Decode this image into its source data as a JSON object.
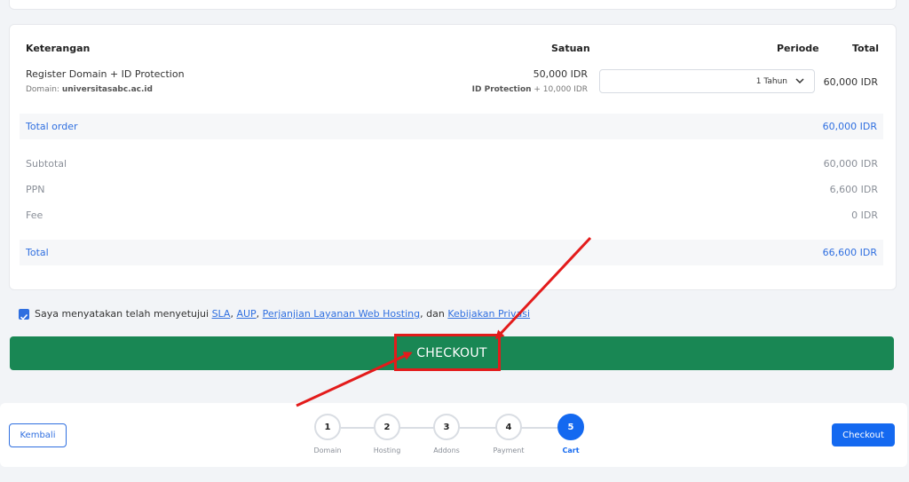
{
  "table": {
    "headers": {
      "keterangan": "Keterangan",
      "satuan": "Satuan",
      "periode": "Periode",
      "total": "Total"
    },
    "item": {
      "name": "Register Domain + ID Protection",
      "domain_label": "Domain:",
      "domain_value": "universitasabc.ac.id",
      "price": "50,000 IDR",
      "extra_label": "ID Protection",
      "extra_value": "+ 10,000 IDR",
      "period": "1 Tahun",
      "total": "60,000 IDR"
    },
    "total_order": {
      "label": "Total order",
      "value": "60,000 IDR"
    },
    "summary": [
      {
        "label": "Subtotal",
        "value": "60,000 IDR"
      },
      {
        "label": "PPN",
        "value": "6,600 IDR"
      },
      {
        "label": "Fee",
        "value": "0 IDR"
      }
    ],
    "grand_total": {
      "label": "Total",
      "value": "66,600 IDR"
    }
  },
  "agreement": {
    "prefix": "Saya menyatakan telah menyetujui ",
    "link_sla": "SLA",
    "sep1": ", ",
    "link_aup": "AUP",
    "sep2": ", ",
    "link_perjanjian": "Perjanjian Layanan Web Hosting",
    "sep3": ", dan ",
    "link_kebijakan": "Kebijakan Privasi",
    "checked": true
  },
  "checkout_button": "CHECKOUT",
  "footer": {
    "back_label": "Kembali",
    "checkout_label": "Checkout",
    "steps": [
      {
        "num": "1",
        "label": "Domain"
      },
      {
        "num": "2",
        "label": "Hosting"
      },
      {
        "num": "3",
        "label": "Addons"
      },
      {
        "num": "4",
        "label": "Payment"
      },
      {
        "num": "5",
        "label": "Cart"
      }
    ],
    "active_step": 5
  },
  "colors": {
    "accent": "#1469f0",
    "success": "#198754",
    "annotation": "#e31b1b"
  }
}
